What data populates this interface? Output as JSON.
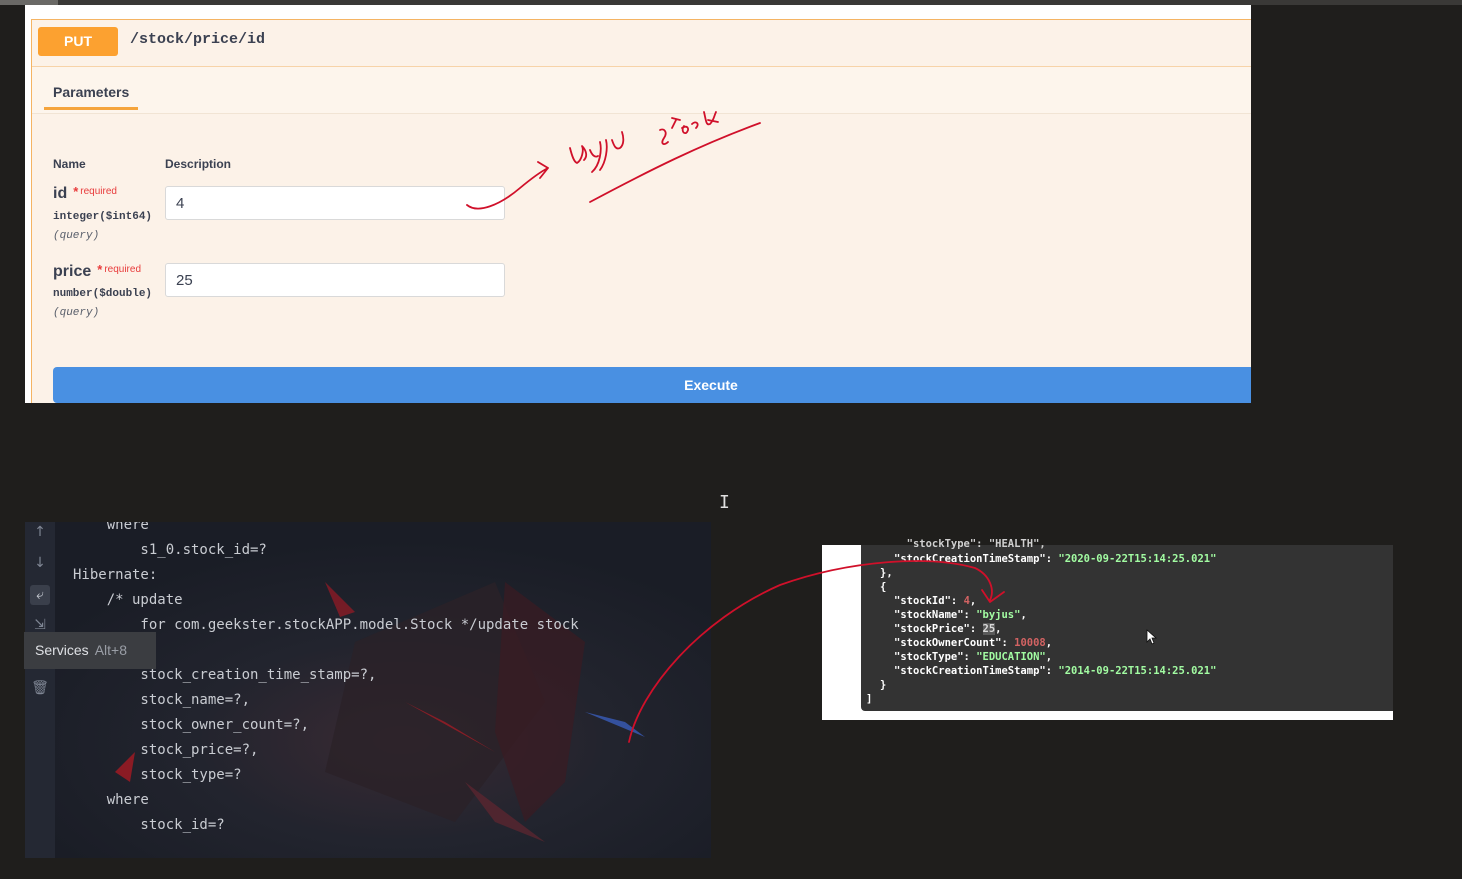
{
  "swagger": {
    "method": "PUT",
    "path": "/stock/price/id",
    "tab_label": "Parameters",
    "col_name": "Name",
    "col_description": "Description",
    "required_label": "required",
    "params": [
      {
        "name": "id",
        "type": "integer($int64)",
        "in": "(query)",
        "value": "4"
      },
      {
        "name": "price",
        "type": "number($double)",
        "in": "(query)",
        "value": "25"
      }
    ],
    "execute_label": "Execute",
    "method_color": "#fca130",
    "execute_color": "#4990e2"
  },
  "annotation": {
    "handwritten_note": "Byju stock",
    "ink_color": "#d0102a"
  },
  "console": {
    "lines": [
      "    where",
      "        s1_0.stock_id=?",
      "Hibernate:",
      "    /* update",
      "        for com.geekster.stockAPP.model.Stock */update stock",
      "",
      "        stock_creation_time_stamp=?,",
      "        stock_name=?,",
      "        stock_owner_count=?,",
      "        stock_price=?,",
      "        stock_type=?",
      "    where",
      "        stock_id=?"
    ],
    "tooltip": {
      "label": "Services",
      "shortcut": "Alt+8"
    },
    "gutter_icons": [
      "arrow-up-icon",
      "arrow-down-icon",
      "soft-wrap-icon",
      "scroll-to-end-icon",
      "trash-icon"
    ]
  },
  "response": {
    "partial_top": "  \"stockType\": \"HEALTH\",",
    "prev_timestamp_key": "\"stockCreationTimeStamp\"",
    "prev_timestamp_value": "\"2020-09-22T15:14:25.021\"",
    "close_obj": "},",
    "open_obj": "{",
    "fields": [
      {
        "key": "\"stockId\"",
        "value": "4",
        "kind": "num"
      },
      {
        "key": "\"stockName\"",
        "value": "\"byjus\"",
        "kind": "str"
      },
      {
        "key": "\"stockPrice\"",
        "value": "25",
        "kind": "sel"
      },
      {
        "key": "\"stockOwnerCount\"",
        "value": "10008",
        "kind": "num"
      },
      {
        "key": "\"stockType\"",
        "value": "\"EDUCATION\"",
        "kind": "str"
      },
      {
        "key": "\"stockCreationTimeStamp\"",
        "value": "\"2014-09-22T15:14:25.021\"",
        "kind": "str",
        "last": true
      }
    ],
    "end_obj": "}",
    "end_arr": "]"
  }
}
